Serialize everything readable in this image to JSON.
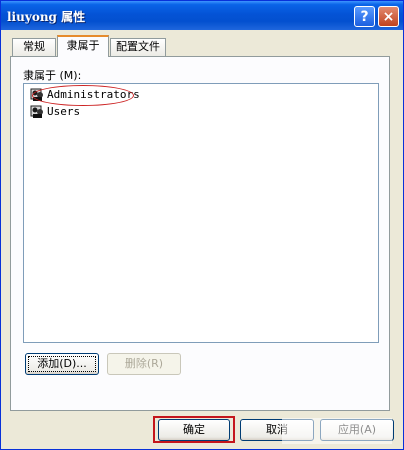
{
  "window": {
    "title": "liuyong 属性",
    "help_icon": "question-mark-icon",
    "close_icon": "close-icon",
    "title_help_glyph": "?",
    "title_close_glyph": "×"
  },
  "tabs": [
    {
      "label": "常规",
      "active": false
    },
    {
      "label": "隶属于",
      "active": true
    },
    {
      "label": "配置文件",
      "active": false
    }
  ],
  "member_of": {
    "label": "隶属于 (M):",
    "items": [
      {
        "name": "Administrators",
        "icon": "group-icon",
        "annotated": true
      },
      {
        "name": "Users",
        "icon": "group-icon",
        "annotated": false
      }
    ]
  },
  "buttons": {
    "add": "添加(D)...",
    "remove": "删除(R)",
    "ok": "确定",
    "cancel": "取消",
    "apply": "应用(A)"
  },
  "colors": {
    "title_bar": "#0453d6",
    "annotation": "#c4161c",
    "active_tab_accent": "#e68b2c"
  }
}
